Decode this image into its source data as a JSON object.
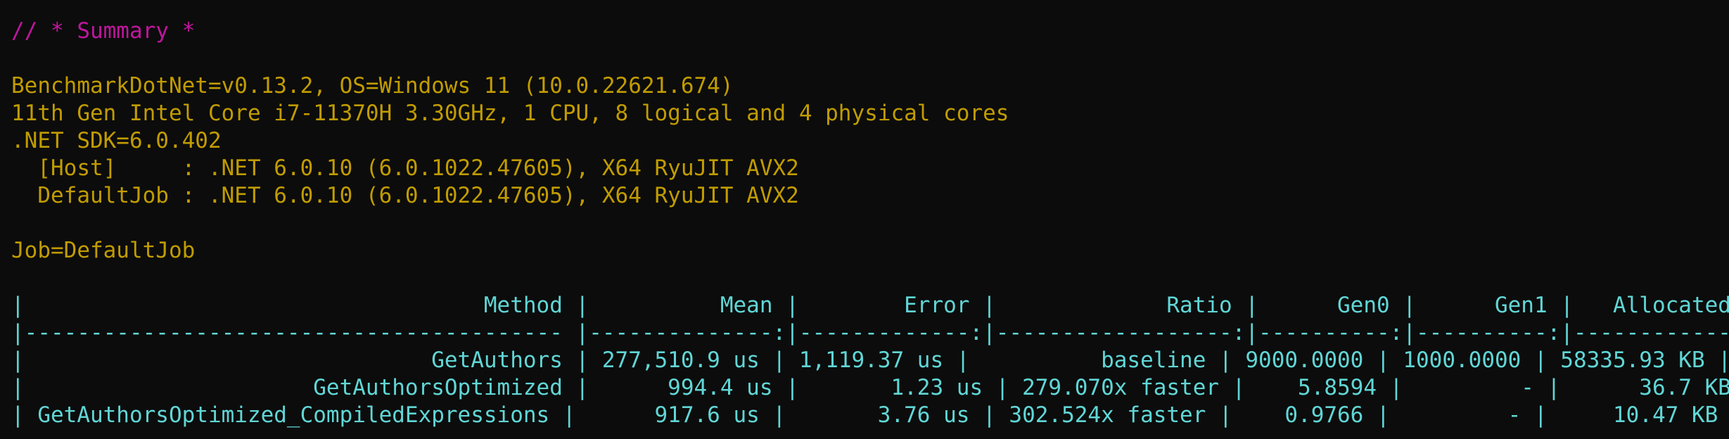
{
  "summary_header": "// * Summary *",
  "environment": [
    "BenchmarkDotNet=v0.13.2, OS=Windows 11 (10.0.22621.674)",
    "11th Gen Intel Core i7-11370H 3.30GHz, 1 CPU, 8 logical and 4 physical cores",
    ".NET SDK=6.0.402",
    "  [Host]     : .NET 6.0.10 (6.0.1022.47605), X64 RyuJIT AVX2",
    "  DefaultJob : .NET 6.0.10 (6.0.1022.47605), X64 RyuJIT AVX2"
  ],
  "job_line": "Job=DefaultJob",
  "table": {
    "header": "|                                   Method |          Mean |        Error |             Ratio |      Gen0 |      Gen1 |   Allocated |",
    "separator": "|----------------------------------------- |--------------:|-------------:|------------------:|----------:|----------:|------------:|",
    "rows": [
      "|                               GetAuthors | 277,510.9 us | 1,119.37 us |          baseline | 9000.0000 | 1000.0000 | 58335.93 KB |",
      "|                      GetAuthorsOptimized |      994.4 us |       1.23 us | 279.070x faster |    5.8594 |         - |      36.7 KB |",
      "| GetAuthorsOptimized_CompiledExpressions |      917.6 us |       3.76 us | 302.524x faster |    0.9766 |         - |     10.47 KB |"
    ]
  },
  "colors": {
    "background": "#0c0c0c",
    "comment": "#c0169e",
    "environment_text": "#c19c00",
    "table_text": "#61d6d6"
  }
}
